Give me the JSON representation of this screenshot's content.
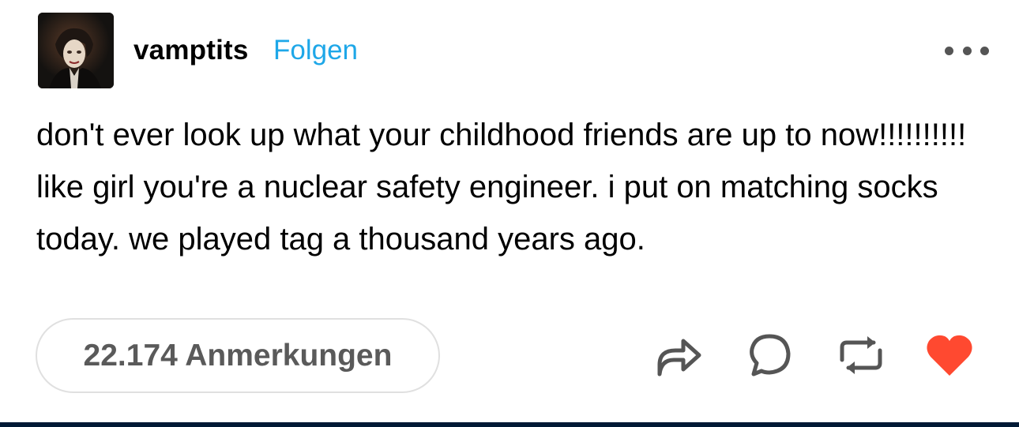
{
  "post": {
    "username": "vamptits",
    "follow_label": "Folgen",
    "text": "don't ever look up what your childhood friends are up to now!!!!!!!!!! like girl you're a nuclear safety engineer. i put on matching socks today. we played tag a thousand years ago.",
    "notes_label": "22.174 Anmerkungen"
  },
  "icons": {
    "avatar": "avatar-photo",
    "more": "more-options-icon",
    "share": "share-icon",
    "reply": "reply-icon",
    "reblog": "reblog-icon",
    "like": "heart-icon"
  },
  "colors": {
    "follow": "#1ea7e8",
    "like": "#ff4930",
    "icon": "#555555",
    "bottom_bar": "#001935"
  }
}
